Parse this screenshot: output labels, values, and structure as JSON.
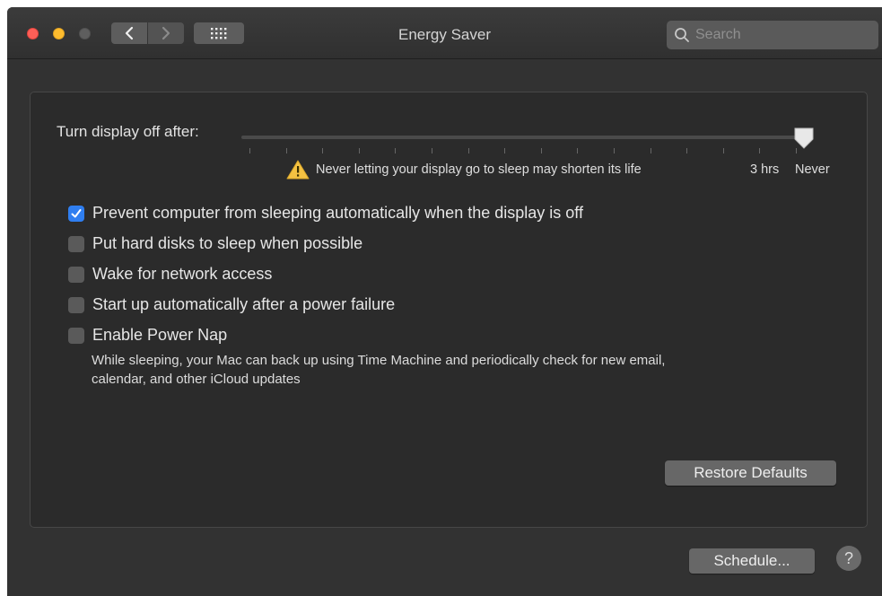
{
  "window": {
    "title": "Energy Saver"
  },
  "toolbar": {
    "back_icon": "chevron-left-icon",
    "forward_icon": "chevron-right-icon",
    "grid_icon": "grid-icon"
  },
  "search": {
    "placeholder": "Search",
    "value": ""
  },
  "display_sleep": {
    "label": "Turn display off after:",
    "value": "Never",
    "warning": "Never letting your display go to sleep may shorten its life",
    "tick_labels": [
      "3 hrs",
      "Never"
    ]
  },
  "options": [
    {
      "label": "Prevent computer from sleeping automatically when the display is off",
      "checked": true
    },
    {
      "label": "Put hard disks to sleep when possible",
      "checked": false
    },
    {
      "label": "Wake for network access",
      "checked": false
    },
    {
      "label": "Start up automatically after a power failure",
      "checked": false
    },
    {
      "label": "Enable Power Nap",
      "checked": false
    }
  ],
  "power_nap_description": {
    "line1": "While sleeping, your Mac can back up using Time Machine and periodically check for new email,",
    "line2": "calendar, and other iCloud updates"
  },
  "buttons": {
    "restore_defaults": "Restore Defaults",
    "schedule": "Schedule...",
    "help": "?"
  },
  "colors": {
    "accent": "#2f7ef0",
    "close": "#fe5f57",
    "minimize": "#febc2e",
    "warning": "#f5c242"
  }
}
